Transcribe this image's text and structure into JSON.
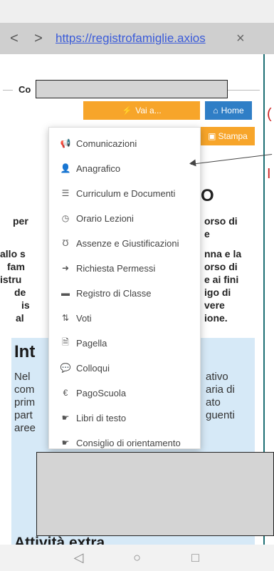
{
  "browser": {
    "back_label": "<",
    "forward_label": ">",
    "url": "https://registrofamiglie.axios",
    "close_label": "×"
  },
  "page": {
    "section_label": "Co",
    "vai_button": "Vai a...",
    "home_button": "Home",
    "stampa_button": "Stampa",
    "right_marker_top": "(",
    "right_marker_bottom": "I",
    "big_letter": "O",
    "left_lines": [
      "per",
      "allo s",
      "fam",
      "istru",
      "de",
      "is",
      "al"
    ],
    "right_lines": [
      "orso di",
      "e",
      "nna e la",
      "orso di",
      "e ai fini",
      "igo di",
      "vere",
      "ione."
    ],
    "intro_title": "Int",
    "intro_left": [
      "Nel",
      "com",
      "prim",
      "part",
      "aree"
    ],
    "intro_right": [
      "ativo",
      "aria di",
      "ato",
      "guenti"
    ],
    "extra_title": "Attività extra"
  },
  "menu": {
    "items": [
      {
        "icon": "megaphone-icon",
        "label": "Comunicazioni"
      },
      {
        "icon": "user-icon",
        "label": "Anagrafico"
      },
      {
        "icon": "list-icon",
        "label": "Curriculum e Documenti"
      },
      {
        "icon": "clock-icon",
        "label": "Orario Lezioni"
      },
      {
        "icon": "stethoscope-icon",
        "label": "Assenze e Giustificazioni"
      },
      {
        "icon": "sign-in-icon",
        "label": "Richiesta Permessi"
      },
      {
        "icon": "book-icon",
        "label": "Registro di Classe"
      },
      {
        "icon": "sort-icon",
        "label": "Voti"
      },
      {
        "icon": "file-icon",
        "label": "Pagella"
      },
      {
        "icon": "chat-icon",
        "label": "Colloqui"
      },
      {
        "icon": "euro-icon",
        "label": "PagoScuola"
      },
      {
        "icon": "hand-icon",
        "label": "Libri di testo"
      },
      {
        "icon": "hand-icon",
        "label": "Consiglio di orientamento"
      }
    ]
  },
  "colors": {
    "orange": "#f7a52a",
    "blue": "#2f7ec6",
    "light_blue_bg": "#d6e9f7",
    "red_marker": "#cc2222"
  }
}
